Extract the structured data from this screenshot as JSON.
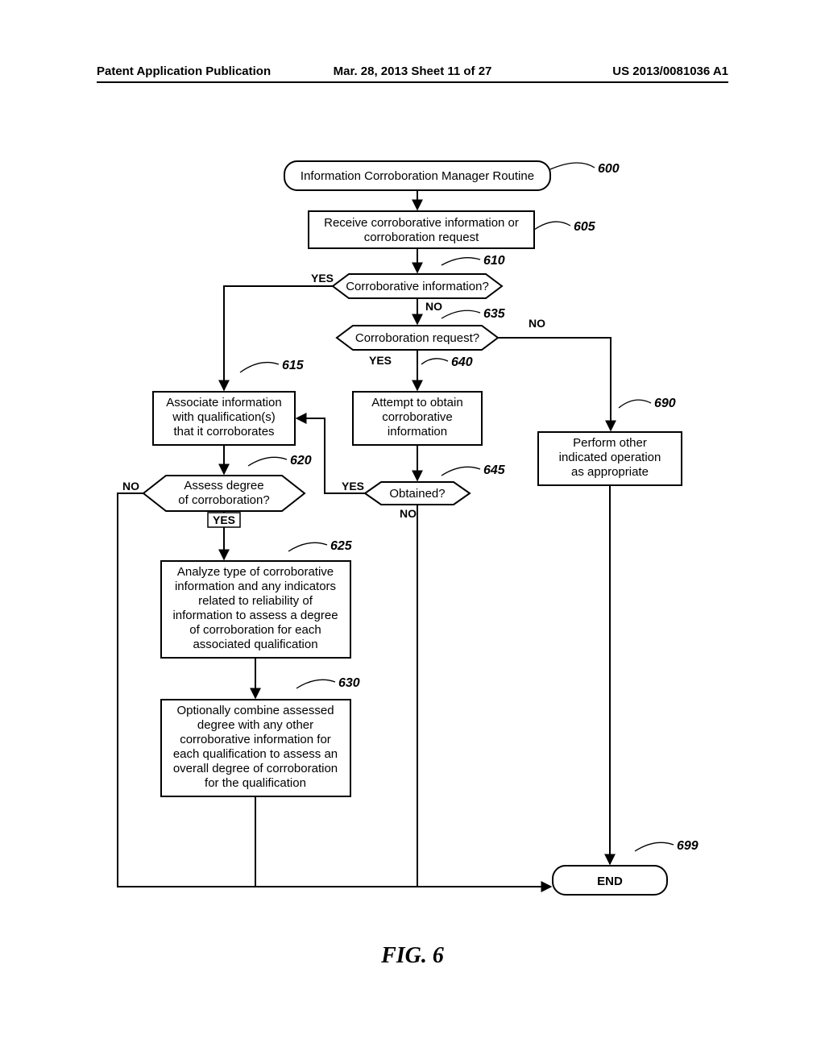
{
  "header": {
    "left": "Patent Application Publication",
    "mid": "Mar. 28, 2013  Sheet 11 of 27",
    "right": "US 2013/0081036 A1"
  },
  "figure_caption": "FIG.  6",
  "refs": {
    "r600": "600",
    "r605": "605",
    "r610": "610",
    "r615": "615",
    "r620": "620",
    "r625": "625",
    "r630": "630",
    "r635": "635",
    "r640": "640",
    "r645": "645",
    "r690": "690",
    "r699": "699"
  },
  "nodes": {
    "start": "Information Corroboration Manager Routine",
    "n605_l1": "Receive corroborative information or",
    "n605_l2": "corroboration request",
    "d610": "Corroborative information?",
    "d635": "Corroboration request?",
    "n615_l1": "Associate information",
    "n615_l2": "with qualification(s)",
    "n615_l3": "that it corroborates",
    "n640_l1": "Attempt to obtain",
    "n640_l2": "corroborative",
    "n640_l3": "information",
    "n690_l1": "Perform other",
    "n690_l2": "indicated operation",
    "n690_l3": "as appropriate",
    "d620_l1": "Assess degree",
    "d620_l2": "of corroboration?",
    "d645": "Obtained?",
    "n625_l1": "Analyze type of corroborative",
    "n625_l2": "information and any indicators",
    "n625_l3": "related to reliability of",
    "n625_l4": "information to assess a degree",
    "n625_l5": "of corroboration for each",
    "n625_l6": "associated qualification",
    "n630_l1": "Optionally combine assessed",
    "n630_l2": "degree with any other",
    "n630_l3": "corroborative information for",
    "n630_l4": "each qualification to assess an",
    "n630_l5": "overall degree of corroboration",
    "n630_l6": "for the qualification",
    "end": "END"
  },
  "edges": {
    "yes": "YES",
    "no": "NO"
  }
}
